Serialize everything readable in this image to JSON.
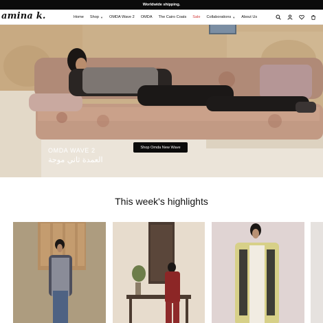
{
  "announcement": "Worldwide shipping.",
  "brand": {
    "logo_text": "amina k."
  },
  "nav": {
    "items": [
      {
        "label": "Home",
        "dropdown": false
      },
      {
        "label": "Shop",
        "dropdown": true
      },
      {
        "label": "OMDA Wave 2",
        "dropdown": false
      },
      {
        "label": "OMDA",
        "dropdown": false
      },
      {
        "label": "The Cairo Coats",
        "dropdown": false
      },
      {
        "label": "Sale",
        "dropdown": false,
        "color": "#d23b3b"
      },
      {
        "label": "Collaborations",
        "dropdown": true
      },
      {
        "label": "About Us",
        "dropdown": false
      }
    ]
  },
  "tools": [
    "search-icon",
    "account-icon",
    "wishlist-icon",
    "cart-icon"
  ],
  "hero": {
    "title": "OMDA WAVE 2",
    "arabic": "العمدة ثاني موجة",
    "button": "Shop Omda New Wave"
  },
  "highlights": {
    "title": "This week's highlights"
  },
  "colors": {
    "announcement_bg": "#0b0b0b",
    "sale": "#d23b3b",
    "button_bg": "#0b0b0b"
  }
}
